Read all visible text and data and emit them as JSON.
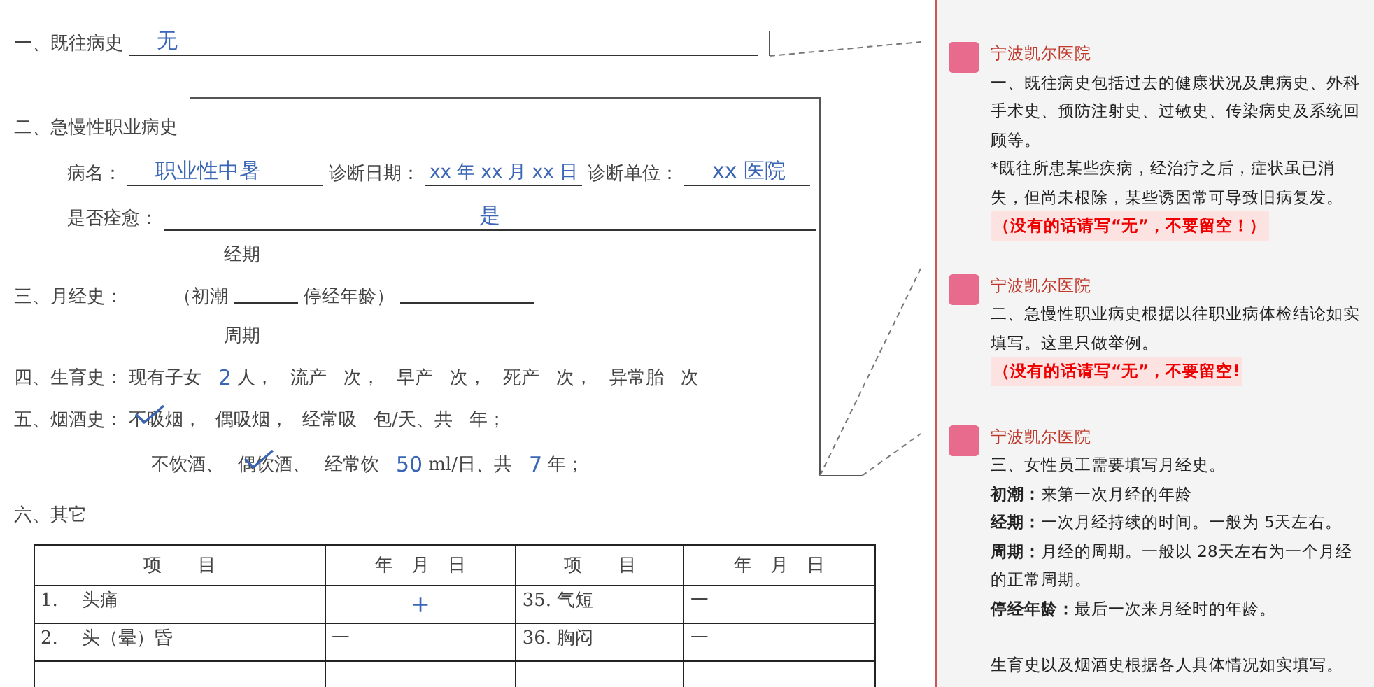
{
  "document": {
    "past_history": {
      "label": "一、既往病史",
      "value": "无"
    },
    "occupational": {
      "label": "二、急慢性职业病史",
      "disease_label": "病名：",
      "disease": "职业性中暑",
      "date_label": "诊断日期：",
      "date": "xx 年 xx 月 xx 日",
      "unit_label": "诊断单位：",
      "unit": "xx 医院",
      "cured_label": "是否痊愈：",
      "cured": "是"
    },
    "menstrual": {
      "top": "经期",
      "label": "三、月经史：",
      "open": "（初潮",
      "middle": "停经年龄）",
      "bottom": "周期"
    },
    "fertility": {
      "label": "四、生育史：",
      "items": [
        {
          "kind": "text",
          "text": "现有子女"
        },
        {
          "kind": "hand",
          "text": "2"
        },
        {
          "kind": "text",
          "text": "人，"
        },
        {
          "kind": "text",
          "text": "流产"
        },
        {
          "kind": "text",
          "text": "次，"
        },
        {
          "kind": "text",
          "text": "早产"
        },
        {
          "kind": "text",
          "text": "次，"
        },
        {
          "kind": "text",
          "text": "死产"
        },
        {
          "kind": "text",
          "text": "次，"
        },
        {
          "kind": "text",
          "text": "异常胎"
        },
        {
          "kind": "text",
          "text": "次"
        }
      ]
    },
    "habits": {
      "label": "五、烟酒史：",
      "smoking": [
        {
          "kind": "option",
          "text": "不吸烟，",
          "checked": true
        },
        {
          "kind": "option",
          "text": "偶吸烟，",
          "checked": false
        },
        {
          "kind": "text",
          "text": "经常吸"
        },
        {
          "kind": "text",
          "text": "包/天、共"
        },
        {
          "kind": "text",
          "text": "年；"
        }
      ],
      "drinking": [
        {
          "kind": "option",
          "text": "不饮酒、",
          "checked": false
        },
        {
          "kind": "option",
          "text": "偶饮酒、",
          "checked": true
        },
        {
          "kind": "text",
          "text": "经常饮"
        },
        {
          "kind": "hand",
          "text": "50"
        },
        {
          "kind": "text",
          "text": "ml/日、共"
        },
        {
          "kind": "hand",
          "text": "7"
        },
        {
          "kind": "text",
          "text": "年；"
        }
      ]
    },
    "other": {
      "label": "六、其它"
    },
    "table": {
      "columns": [
        "项　　目",
        "年　月　日",
        "项　　目",
        "年　月　日"
      ],
      "rows": [
        [
          {
            "text": "1.　 头痛",
            "hand": false
          },
          {
            "text": "＋",
            "hand": true
          },
          {
            "text": "35.  气短",
            "hand": false
          },
          {
            "text": "一",
            "hand": false
          }
        ],
        [
          {
            "text": "2.　 头（晕）昏",
            "hand": false
          },
          {
            "text": "一",
            "hand": false
          },
          {
            "text": "36.  胸闷",
            "hand": false
          },
          {
            "text": "一",
            "hand": false
          }
        ]
      ]
    }
  },
  "comments": [
    {
      "author": "宁波凯尔医院",
      "paragraphs": [
        {
          "kind": "normal",
          "text": "一、既往病史包括过去的健康状况及患病史、外科手术史、预防注射史、过敏史、传染病史及系统回顾等。"
        },
        {
          "kind": "normal",
          "text": "*既往所患某些疾病，经治疗之后，症状虽已消失，但尚未根除，某些诱因常可导致旧病复发。"
        },
        {
          "kind": "warning",
          "text": "（没有的话请写“无”，不要留空！）"
        }
      ]
    },
    {
      "author": "宁波凯尔医院",
      "paragraphs": [
        {
          "kind": "normal",
          "text": "二、急慢性职业病史根据以往职业病体检结论如实填写。这里只做举例。"
        },
        {
          "kind": "warning",
          "text": "（没有的话请写“无”，不要留空!"
        }
      ]
    },
    {
      "author": "宁波凯尔医院",
      "paragraphs": [
        {
          "kind": "normal",
          "text": "三、女性员工需要填写月经史。"
        },
        {
          "kind": "normal",
          "text": "**初潮：**来第一次月经的年龄"
        },
        {
          "kind": "normal",
          "text": "**经期：**一次月经持续的时间。一般为 5天左右。"
        },
        {
          "kind": "normal",
          "text": "**周期：**月经的周期。一般以 28天左右为一个月经的正常周期。"
        },
        {
          "kind": "normal",
          "text": "**停经年龄：**最后一次来月经时的年龄。"
        },
        {
          "kind": "spaced",
          "text": "生育史以及烟酒史根据各人具体情况如实填写。"
        }
      ]
    }
  ]
}
